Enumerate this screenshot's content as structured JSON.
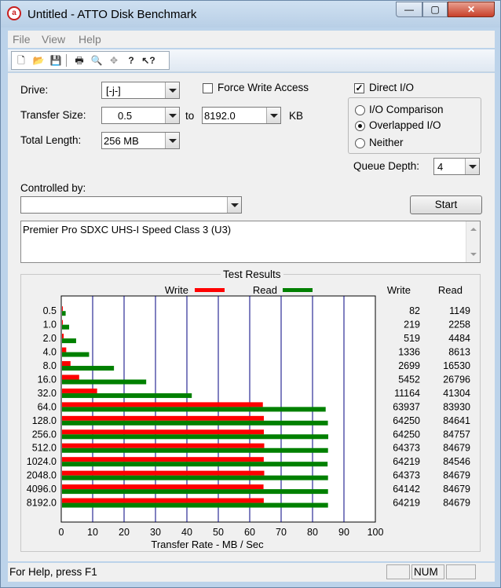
{
  "window": {
    "title": "Untitled - ATTO Disk Benchmark",
    "min_glyph": "—",
    "max_glyph": "▢",
    "close_glyph": "✕",
    "icon_glyph": "a"
  },
  "menu": [
    "File",
    "View",
    "Help"
  ],
  "toolbar": {
    "icons": [
      "new-icon",
      "open-icon",
      "save-icon",
      "print-icon",
      "print-preview-icon",
      "move-icon",
      "help-icon",
      "context-help-icon"
    ],
    "glyphs": [
      "🗋",
      "📂",
      "💾",
      "🖶",
      "🔍",
      "✥",
      "?",
      "↖?"
    ]
  },
  "form": {
    "drive_label": "Drive:",
    "drive_value": "[-j-]",
    "transfer_size_label": "Transfer Size:",
    "transfer_from": "0.5",
    "to_label": "to",
    "transfer_to": "8192.0",
    "kb_label": "KB",
    "total_length_label": "Total Length:",
    "total_length_value": "256 MB",
    "force_write_label": "Force Write Access",
    "force_write_checked": false,
    "direct_io_label": "Direct I/O",
    "direct_io_checked": true,
    "io_comparison_label": "I/O Comparison",
    "overlapped_io_label": "Overlapped I/O",
    "neither_label": "Neither",
    "selected_io_mode": "Overlapped I/O",
    "queue_depth_label": "Queue Depth:",
    "queue_depth_value": "4",
    "controlled_by_label": "Controlled by:",
    "controlled_by_value": "",
    "start_label": "Start",
    "description": "Premier Pro SDXC UHS-I Speed Class 3 (U3)"
  },
  "colors": {
    "write": "#ff0000",
    "read": "#008000",
    "grid": "#000080"
  },
  "chart_data": {
    "type": "bar",
    "orientation": "horizontal",
    "title": "Test Results",
    "xlabel": "Transfer Rate - MB / Sec",
    "xlim": [
      0,
      100
    ],
    "xticks": [
      0,
      10,
      20,
      30,
      40,
      50,
      60,
      70,
      80,
      90,
      100
    ],
    "categories": [
      "0.5",
      "1.0",
      "2.0",
      "4.0",
      "8.0",
      "16.0",
      "32.0",
      "64.0",
      "128.0",
      "256.0",
      "512.0",
      "1024.0",
      "2048.0",
      "4096.0",
      "8192.0"
    ],
    "series": [
      {
        "name": "Write",
        "values_kb_per_s": [
          82,
          219,
          519,
          1336,
          2699,
          5452,
          11164,
          63937,
          64250,
          64250,
          64373,
          64219,
          64373,
          64142,
          64219
        ]
      },
      {
        "name": "Read",
        "values_kb_per_s": [
          1149,
          2258,
          4484,
          8613,
          16530,
          26796,
          41304,
          83930,
          84641,
          84757,
          84679,
          84546,
          84679,
          84679,
          84679
        ]
      }
    ],
    "table_headers": [
      "Write",
      "Read"
    ]
  },
  "status": {
    "help_text": "For Help, press F1",
    "num_label": "NUM"
  }
}
